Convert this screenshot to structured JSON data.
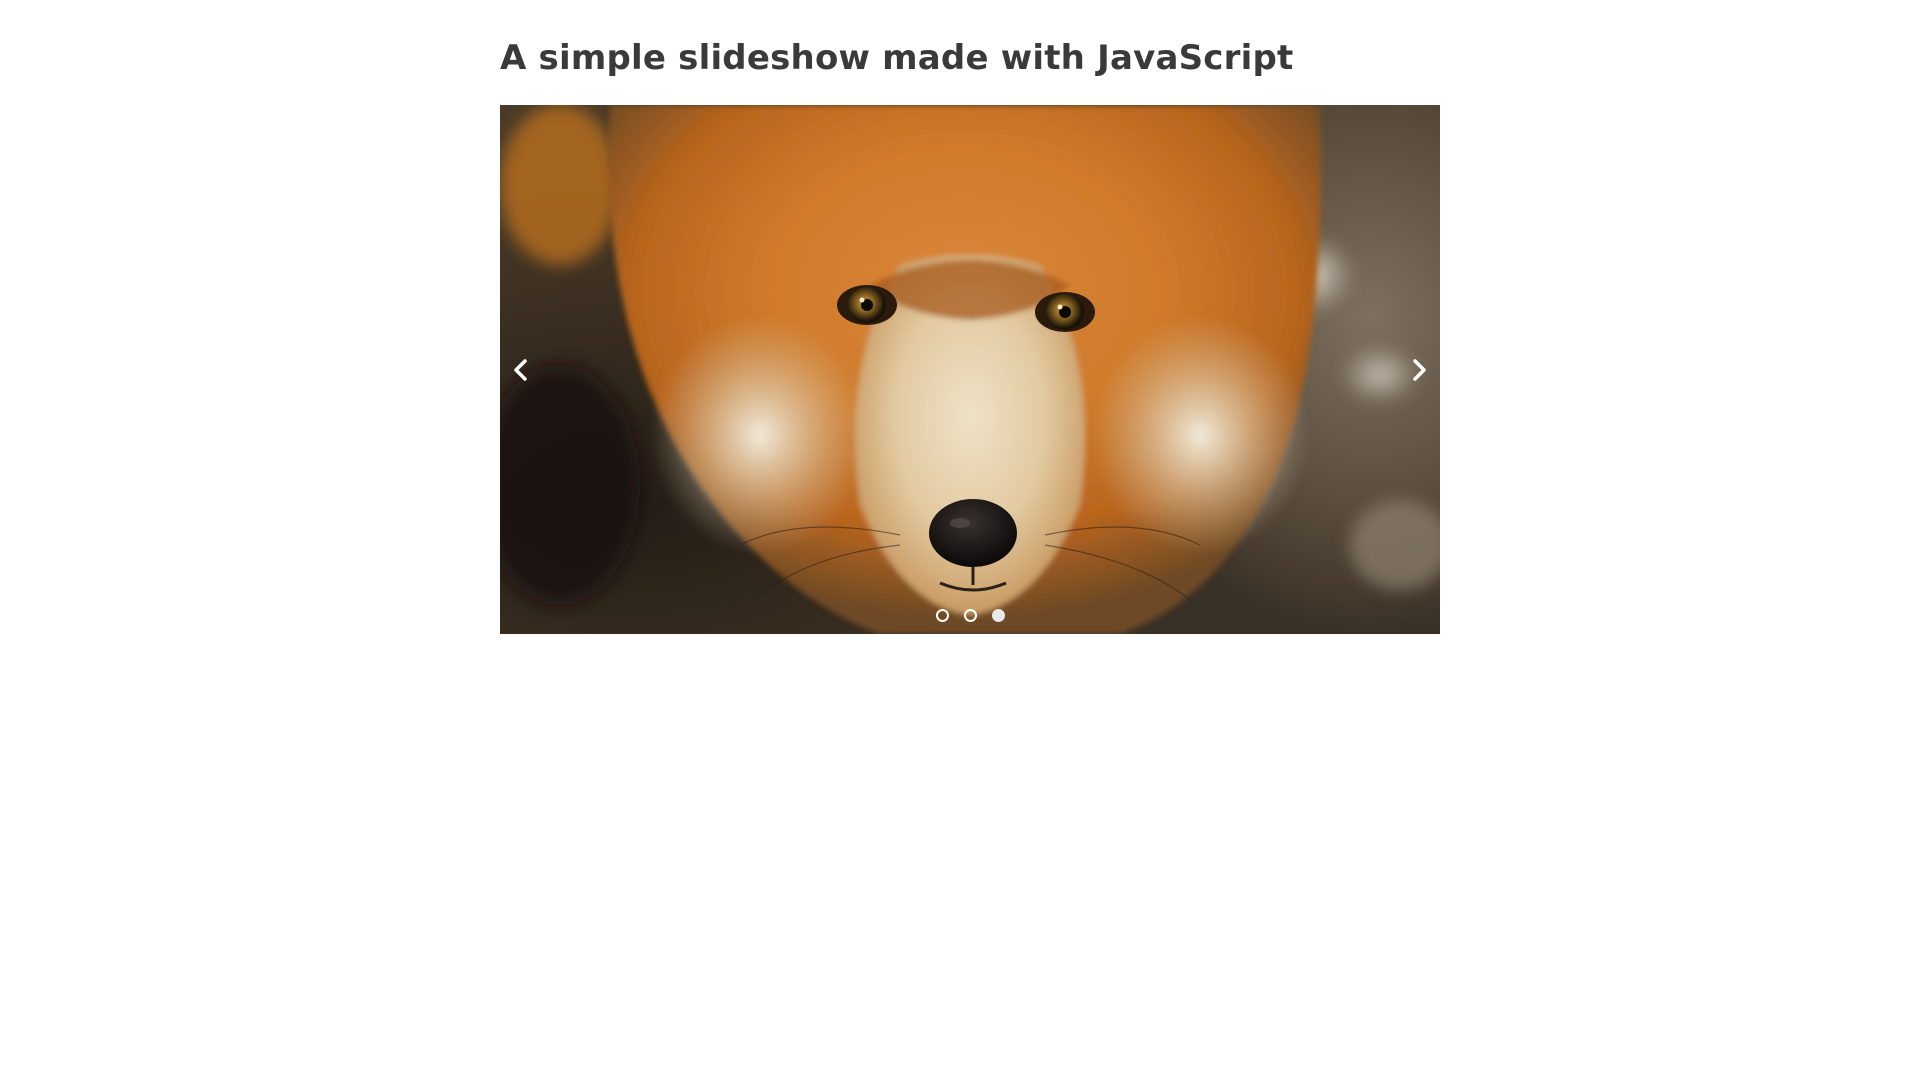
{
  "page": {
    "title": "A simple slideshow made with JavaScript"
  },
  "slideshow": {
    "current_slide": 3,
    "slide_count": 3,
    "prev_icon": "chevron-left-icon",
    "next_icon": "chevron-right-icon",
    "dots": [
      {
        "active": false
      },
      {
        "active": false
      },
      {
        "active": true
      }
    ]
  },
  "colors": {
    "title": "#3a3a3a",
    "controls": "#ffffff"
  }
}
